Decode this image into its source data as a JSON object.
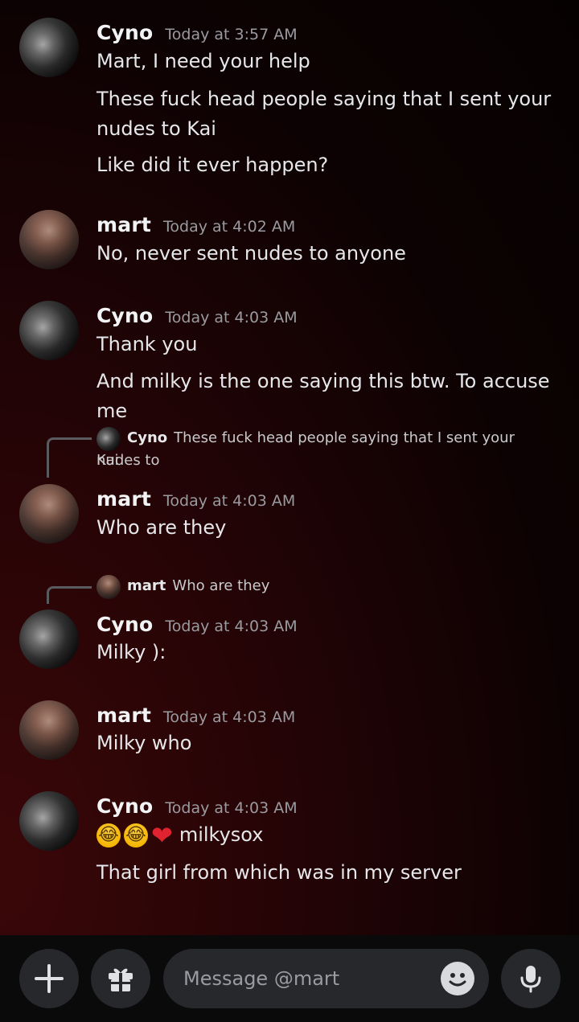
{
  "conversation": {
    "messages": [
      {
        "author": "Cyno",
        "timestamp": "Today at 3:57 AM",
        "lines": [
          "Mart, I need your help",
          "These fuck head people saying that I sent your",
          "nudes to Kai",
          "Like did it ever happen?"
        ]
      },
      {
        "author": "mart",
        "timestamp": "Today at 4:02 AM",
        "lines": [
          "No, never sent nudes to anyone"
        ]
      },
      {
        "author": "Cyno",
        "timestamp": "Today at 4:03 AM",
        "lines": [
          "Thank you",
          "And milky is the one saying this btw. To accuse me"
        ]
      },
      {
        "reply_to": {
          "author": "Cyno",
          "text_line1": "These fuck head people saying that I sent your nudes to",
          "text_line2": "Kai"
        },
        "author": "mart",
        "timestamp": "Today at 4:03 AM",
        "lines": [
          "Who are they"
        ]
      },
      {
        "reply_to": {
          "author": "mart",
          "text": "Who are they"
        },
        "author": "Cyno",
        "timestamp": "Today at 4:03 AM",
        "lines": [
          "Milky ):"
        ]
      },
      {
        "author": "mart",
        "timestamp": "Today at 4:03 AM",
        "lines": [
          "Milky who"
        ]
      },
      {
        "author": "Cyno",
        "timestamp": "Today at 4:03 AM",
        "emoji_line": {
          "emojis": [
            "😂",
            "😂",
            "❤"
          ],
          "text": "milkysox"
        },
        "lines": [
          "That girl from which was in my server"
        ]
      }
    ]
  },
  "composer": {
    "placeholder": "Message @mart",
    "add_icon": "plus-icon",
    "gift_icon": "gift-icon",
    "emoji_icon": "smile-icon",
    "mic_icon": "microphone-icon"
  }
}
